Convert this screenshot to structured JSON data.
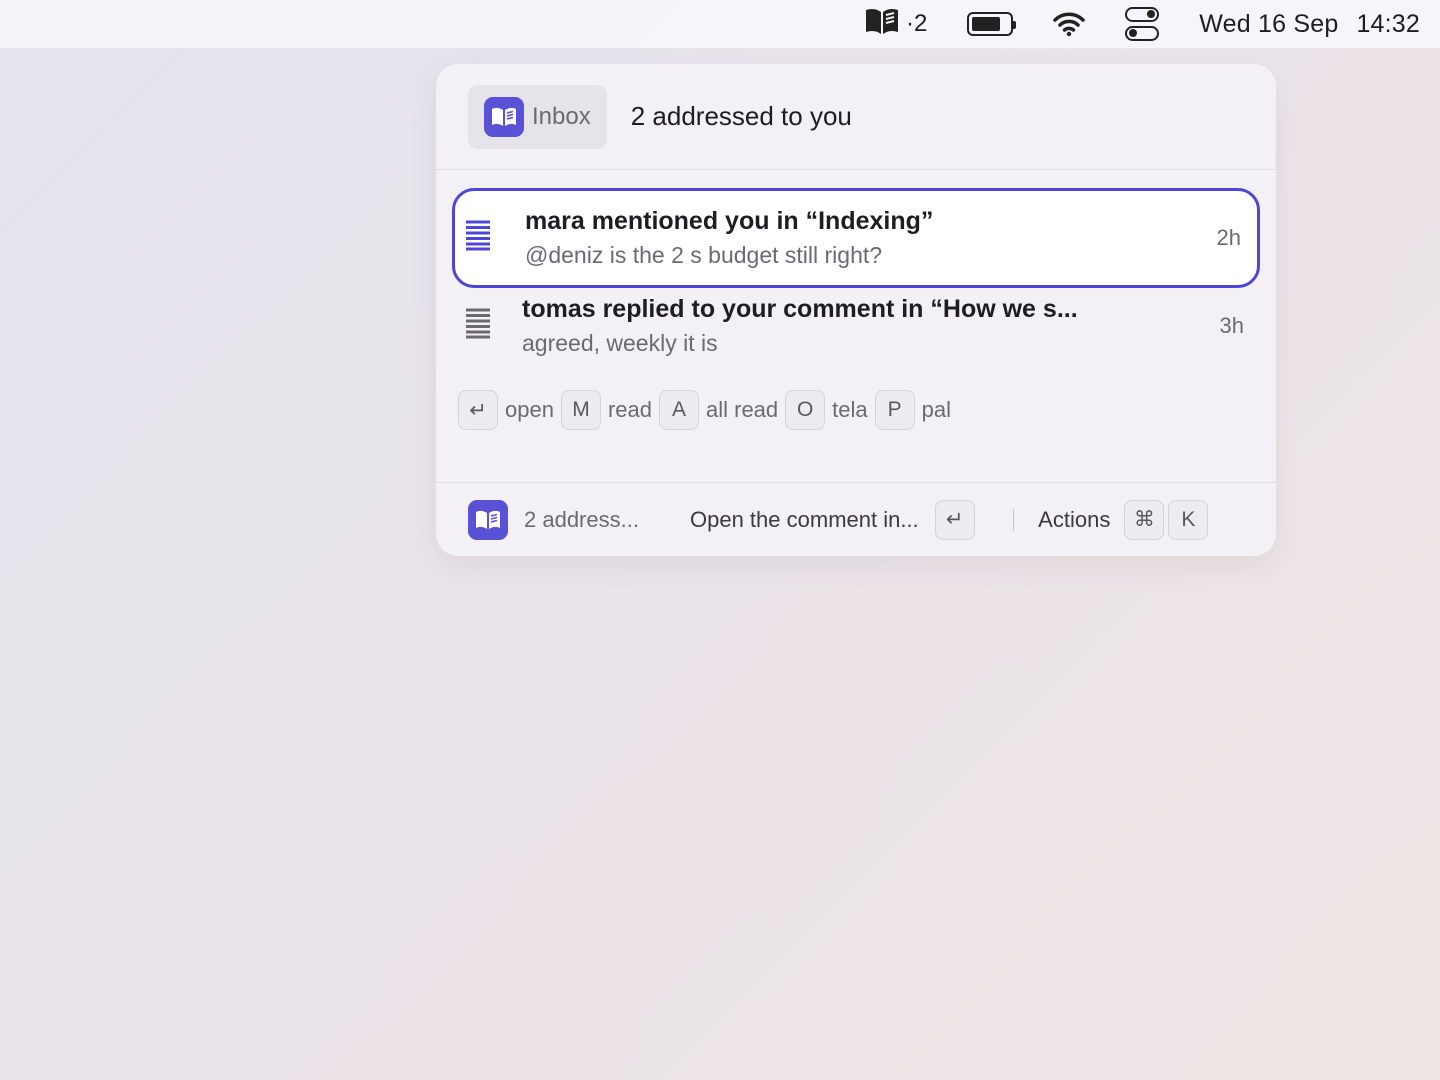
{
  "menubar": {
    "app_badge": "·2",
    "date": "Wed 16 Sep",
    "time": "14:32",
    "icons": [
      "book-icon",
      "battery-icon",
      "wifi-icon",
      "control-center-icon"
    ]
  },
  "header": {
    "inbox_label": "Inbox",
    "title": "2 addressed to you"
  },
  "notifications": [
    {
      "title": "mara mentioned you in “Indexing”",
      "snippet": "@deniz is the 2 s budget still right?",
      "age": "2h",
      "selected": true
    },
    {
      "title": "tomas replied to your comment in “How we s...",
      "snippet": "agreed, weekly it is",
      "age": "3h",
      "selected": false
    }
  ],
  "shortcuts": [
    {
      "key": "↵",
      "label": "open"
    },
    {
      "key": "M",
      "label": "read"
    },
    {
      "key": "A",
      "label": "all read"
    },
    {
      "key": "O",
      "label": "tela"
    },
    {
      "key": "P",
      "label": "pal"
    }
  ],
  "footer": {
    "crumb": "2 address...",
    "primary_action": "Open the comment in...",
    "primary_key": "↵",
    "actions_label": "Actions",
    "actions_keys": [
      "⌘",
      "K"
    ]
  },
  "colors": {
    "accent": "#4f46d8",
    "app_icon_bg": "#5a52d6"
  }
}
